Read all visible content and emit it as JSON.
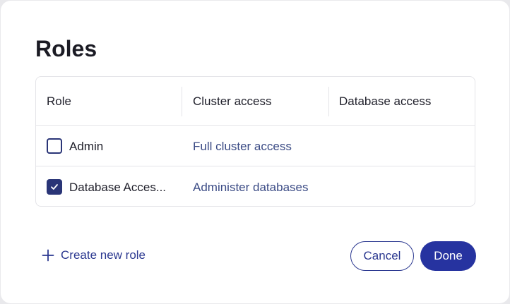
{
  "dialog": {
    "title": "Roles"
  },
  "table": {
    "headers": [
      "Role",
      "Cluster access",
      "Database access"
    ],
    "rows": [
      {
        "role": "Admin",
        "cluster_access": "Full cluster access",
        "database_access": "",
        "checked": false
      },
      {
        "role": "Database Acces...",
        "cluster_access": "Administer databases",
        "database_access": "",
        "checked": true
      }
    ]
  },
  "footer": {
    "create_label": "Create new role",
    "cancel_label": "Cancel",
    "done_label": "Done"
  },
  "icons": {
    "create": "plus-icon",
    "checkbox_check": "check-icon"
  },
  "colors": {
    "accent": "#2633a0",
    "link": "#3b4b85",
    "text": "#1b1b24"
  }
}
